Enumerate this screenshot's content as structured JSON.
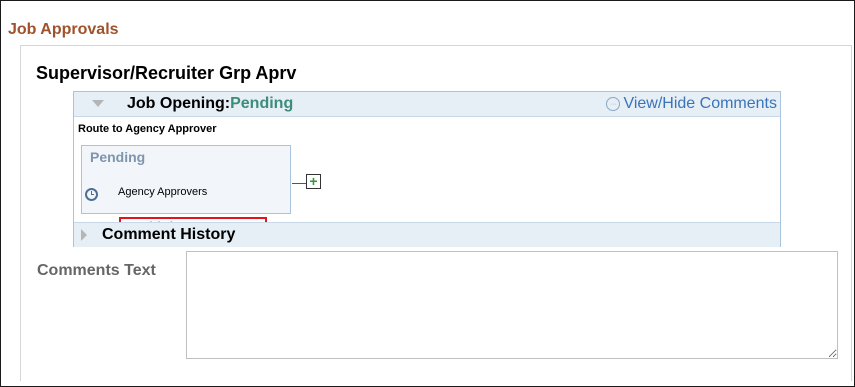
{
  "section": {
    "title": "Job Approvals"
  },
  "approval": {
    "title": "Supervisor/Recruiter Grp Aprv"
  },
  "job_opening": {
    "label": "Job Opening:",
    "status": "Pending",
    "comments_link": "View/Hide Comments"
  },
  "route": {
    "text": "Route to Agency Approver"
  },
  "step": {
    "status": "Pending",
    "approver_link": "Multiple Approvers",
    "approver_group": "Agency Approvers"
  },
  "comment_history": {
    "label": "Comment History"
  },
  "comments": {
    "label": "Comments Text",
    "value": ""
  },
  "icons": {
    "collapse": "caret-down-icon",
    "expand": "caret-right-icon",
    "comments": "speech-bubble-icon",
    "clock": "clock-icon",
    "add": "plus-icon"
  },
  "colors": {
    "section_title": "#a0522d",
    "link": "#3b73b9",
    "status": "#3c8d7a",
    "highlight": "#e0161a",
    "add_icon": "#2e9b34"
  }
}
